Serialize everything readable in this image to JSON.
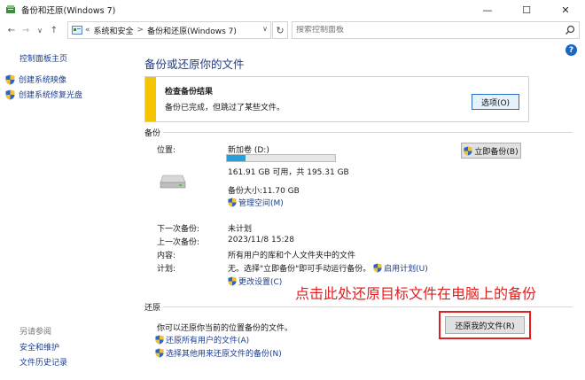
{
  "window": {
    "title": "备份和还原(Windows 7)",
    "minimize": "—",
    "maximize": "☐",
    "close": "✕"
  },
  "address": {
    "back": "←",
    "forward": "→",
    "recent": "∨",
    "up": "↑",
    "crumb_prefix": "«",
    "crumbs": [
      "系统和安全",
      "备份和还原(Windows 7)"
    ],
    "separator": ">",
    "dropdown": "∨",
    "refresh": "↻",
    "search_placeholder": "搜索控制面板"
  },
  "help": "?",
  "sidebar": {
    "home": "控制面板主页",
    "items": [
      {
        "label": "创建系统映像",
        "icon": "uac-shield-icon"
      },
      {
        "label": "创建系统修复光盘",
        "icon": "uac-shield-icon"
      }
    ],
    "see_also_heading": "另请参阅",
    "see_also": [
      "安全和维护",
      "文件历史记录"
    ]
  },
  "main": {
    "title": "备份或还原你的文件",
    "notice": {
      "title": "检查备份结果",
      "text": "备份已完成，但跳过了某些文件。",
      "button": "选项(O)",
      "accent": "#f5c400"
    },
    "backup": {
      "section": "备份",
      "location_label": "位置:",
      "drive_name": "新加卷 (D:)",
      "usage_fraction": 0.17,
      "space_text": "161.91 GB 可用，共 195.31 GB",
      "size_text": "备份大小:11.70 GB",
      "manage_link": "管理空间(M)",
      "backup_now": "立即备份(B)",
      "rows": [
        {
          "label": "下一次备份:",
          "value": "未计划"
        },
        {
          "label": "上一次备份:",
          "value": "2023/11/8 15:28"
        },
        {
          "label": "内容:",
          "value": "所有用户的库和个人文件夹中的文件"
        }
      ],
      "schedule_label": "计划:",
      "schedule_value": "无。选择\"立即备份\"即可手动运行备份。",
      "schedule_link": "启用计划(U)",
      "change_settings": "更改设置(C)"
    },
    "restore": {
      "section": "还原",
      "text": "你可以还原你当前的位置备份的文件。",
      "restore_button": "还原我的文件(R)",
      "all_users_link": "还原所有用户的文件(A)",
      "other_backup_link": "选择其他用来还原文件的备份(N)"
    }
  },
  "annotation": {
    "text": "点击此处还原目标文件在电脑上的备份",
    "color": "#e02020"
  }
}
